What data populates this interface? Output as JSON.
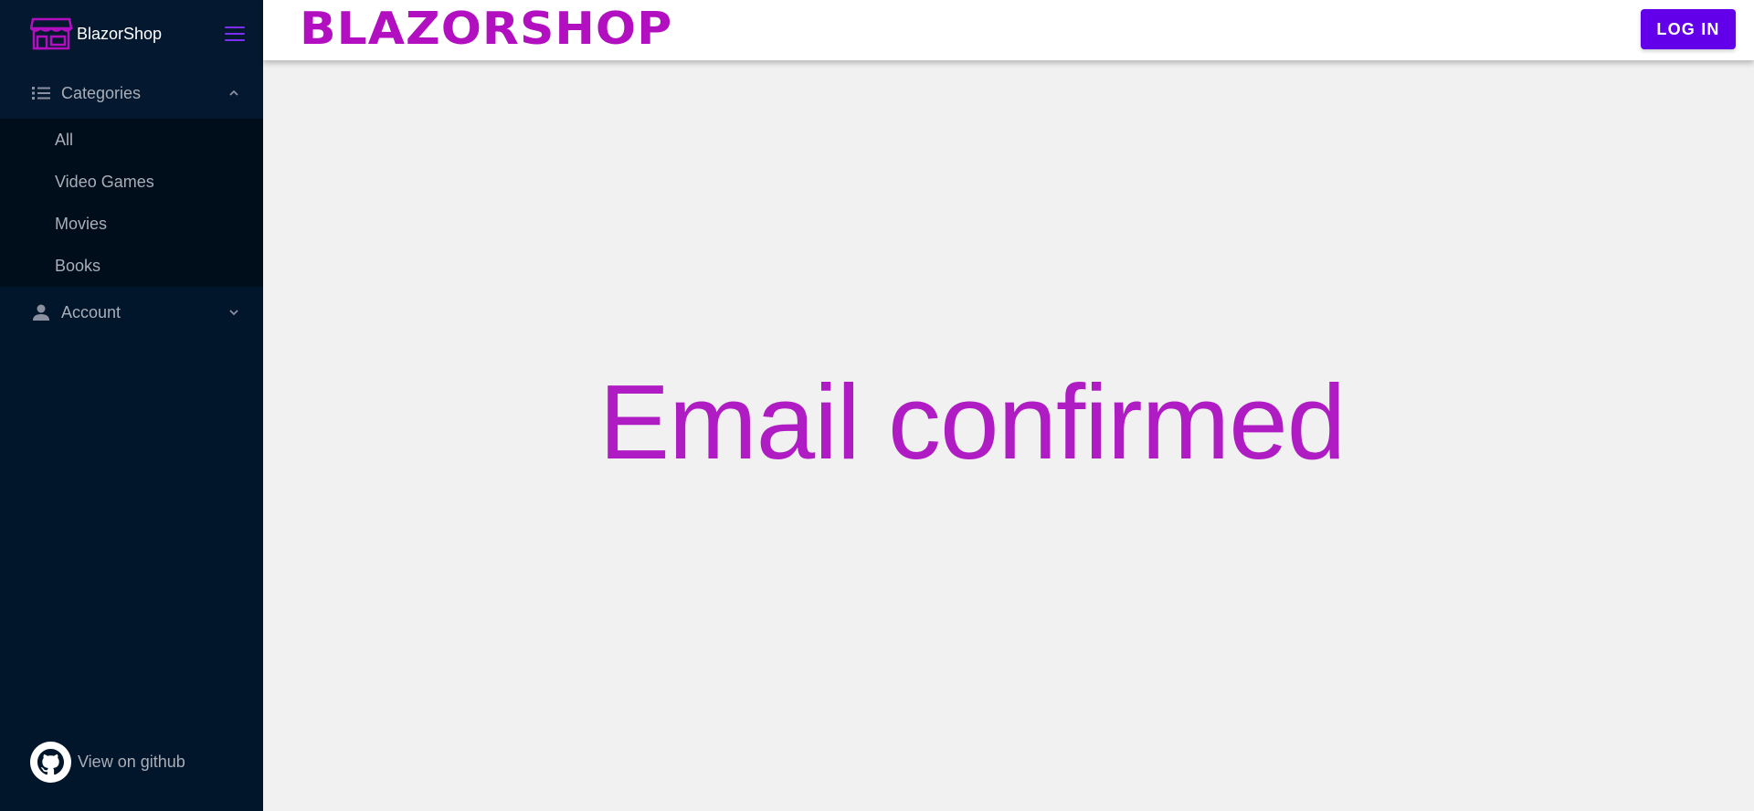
{
  "brand": {
    "name": "BlazorShop"
  },
  "header": {
    "logo_text": "BLAZORSHOP",
    "login_label": "LOG IN"
  },
  "sidebar": {
    "categories": {
      "label": "Categories",
      "items": [
        {
          "label": "All"
        },
        {
          "label": "Video Games"
        },
        {
          "label": "Movies"
        },
        {
          "label": "Books"
        }
      ]
    },
    "account": {
      "label": "Account"
    },
    "github_label": "View on github"
  },
  "main": {
    "message": "Email confirmed"
  },
  "colors": {
    "accent": "#6200ea",
    "brand_magenta": "#b10fbf",
    "sidebar_bg": "#01152b"
  }
}
